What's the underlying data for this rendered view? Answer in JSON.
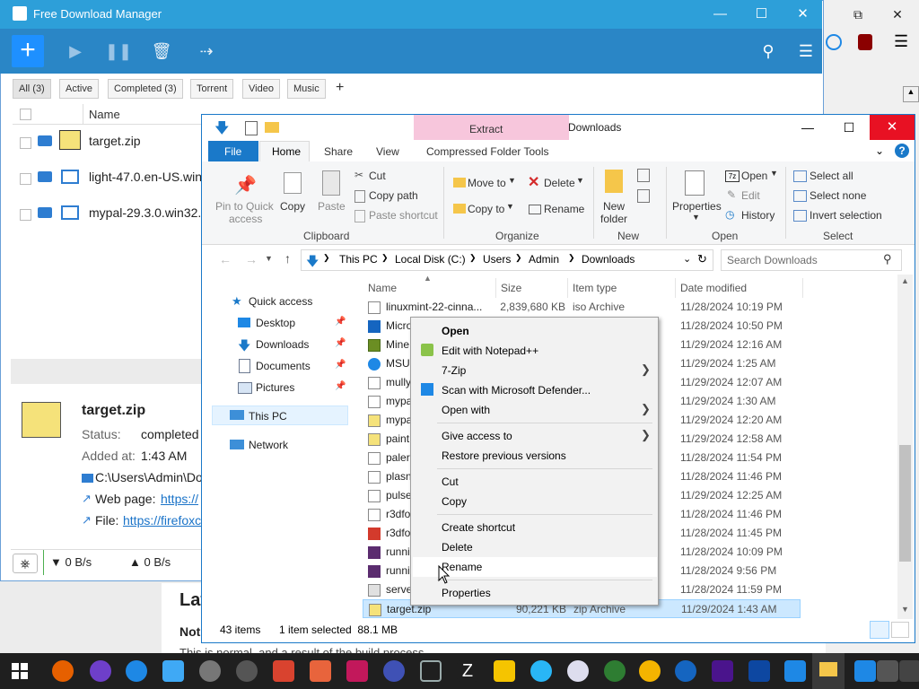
{
  "fdm": {
    "title": "Free Download Manager",
    "filters": [
      "All (3)",
      "Active",
      "Completed (3)",
      "Torrent",
      "Video",
      "Music",
      "+"
    ],
    "column_name": "Name",
    "downloads": [
      "target.zip",
      "light-47.0.en-US.win",
      "mypal-29.3.0.win32."
    ],
    "detail": {
      "file": "target.zip",
      "status_label": "Status:",
      "status_value": "completed",
      "added_label": "Added at:",
      "added_value": "1:43 AM",
      "folder": "C:\\Users\\Admin\\Do",
      "webpage_label": "Web page:",
      "webpage_link": "https://",
      "file_label": "File:",
      "file_link": "https://firefoxc"
    },
    "down_speed": "▼ 0 B/s",
    "up_speed": "▲ 0 B/s"
  },
  "explorer": {
    "title": "Downloads",
    "extract_tab": "Extract",
    "compressed_tools": "Compressed Folder Tools",
    "tabs": {
      "file": "File",
      "home": "Home",
      "share": "Share",
      "view": "View"
    },
    "ribbon": {
      "pin": "Pin to Quick",
      "pin2": "access",
      "copy": "Copy",
      "paste": "Paste",
      "cut": "Cut",
      "copy_path": "Copy path",
      "paste_shortcut": "Paste shortcut",
      "clipboard": "Clipboard",
      "move_to": "Move to",
      "copy_to": "Copy to",
      "delete": "Delete",
      "rename": "Rename",
      "organize": "Organize",
      "new_folder": "New",
      "new_folder2": "folder",
      "new": "New",
      "properties": "Properties",
      "open": "Open",
      "edit": "Edit",
      "history": "History",
      "open_group": "Open",
      "select_all": "Select all",
      "select_none": "Select none",
      "invert": "Invert selection",
      "select_group": "Select"
    },
    "address": [
      "This PC",
      "Local Disk (C:)",
      "Users",
      "Admin",
      "Downloads"
    ],
    "search_placeholder": "Search Downloads",
    "nav": {
      "quick_access": "Quick access",
      "desktop": "Desktop",
      "downloads": "Downloads",
      "documents": "Documents",
      "pictures": "Pictures",
      "this_pc": "This PC",
      "network": "Network"
    },
    "columns": {
      "name": "Name",
      "size": "Size",
      "type": "Item type",
      "date": "Date modified"
    },
    "files": [
      {
        "name": "linuxmint-22-cinna...",
        "size": "2,839,680 KB",
        "type": "iso Archive",
        "date": "11/28/2024 10:19 PM"
      },
      {
        "name": "Micro",
        "size": "",
        "type": "",
        "date": "11/28/2024 10:50 PM"
      },
      {
        "name": "Mine",
        "size": "",
        "type": "",
        "date": "11/29/2024 12:16 AM"
      },
      {
        "name": "MSU",
        "size": "",
        "type": "",
        "date": "11/29/2024 1:25 AM"
      },
      {
        "name": "mully",
        "size": "",
        "type": "",
        "date": "11/29/2024 12:07 AM"
      },
      {
        "name": "mypa",
        "size": "",
        "type": "",
        "date": "11/29/2024 1:30 AM"
      },
      {
        "name": "mypa",
        "size": "",
        "type": "",
        "date": "11/29/2024 12:20 AM"
      },
      {
        "name": "paint",
        "size": "",
        "type": "",
        "date": "11/29/2024 12:58 AM"
      },
      {
        "name": "paler",
        "size": "",
        "type": "",
        "date": "11/28/2024 11:54 PM"
      },
      {
        "name": "plasn",
        "size": "",
        "type": "",
        "date": "11/28/2024 11:46 PM"
      },
      {
        "name": "pulse",
        "size": "",
        "type": "",
        "date": "11/29/2024 12:25 AM"
      },
      {
        "name": "r3dfo",
        "size": "",
        "type": "",
        "date": "11/28/2024 11:46 PM"
      },
      {
        "name": "r3dfo",
        "size": "",
        "type": "",
        "date": "11/28/2024 11:45 PM"
      },
      {
        "name": "runni",
        "size": "",
        "type": "",
        "date": "11/28/2024 10:09 PM"
      },
      {
        "name": "runni",
        "size": "",
        "type": "",
        "date": "11/28/2024 9:56 PM"
      },
      {
        "name": "serve",
        "size": "",
        "type": "",
        "date": "11/28/2024 11:59 PM"
      },
      {
        "name": "target.zip",
        "size": "90,221 KB",
        "type": "zip Archive",
        "date": "11/29/2024 1:43 AM"
      }
    ],
    "status_items": "43 items",
    "status_selected": "1 item selected  88.1 MB"
  },
  "context_menu": {
    "open": "Open",
    "edit_notepad": "Edit with Notepad++",
    "seven_zip": "7-Zip",
    "defender": "Scan with Microsoft Defender...",
    "open_with": "Open with",
    "give_access": "Give access to",
    "restore": "Restore previous versions",
    "cut": "Cut",
    "copy": "Copy",
    "create_shortcut": "Create shortcut",
    "delete": "Delete",
    "rename": "Rename",
    "properties": "Properties"
  },
  "background_page": {
    "heading": "Lat",
    "note": "Not",
    "text": "This is normal, and a result of the build process."
  },
  "colors": {
    "fdm_title": "#2d9fd9",
    "fdm_toolbar": "#2a86c6",
    "explorer_accent": "#1a79c9",
    "selection": "#cce8ff",
    "close_red": "#e81123",
    "extract_tab": "#f7c6dc"
  }
}
